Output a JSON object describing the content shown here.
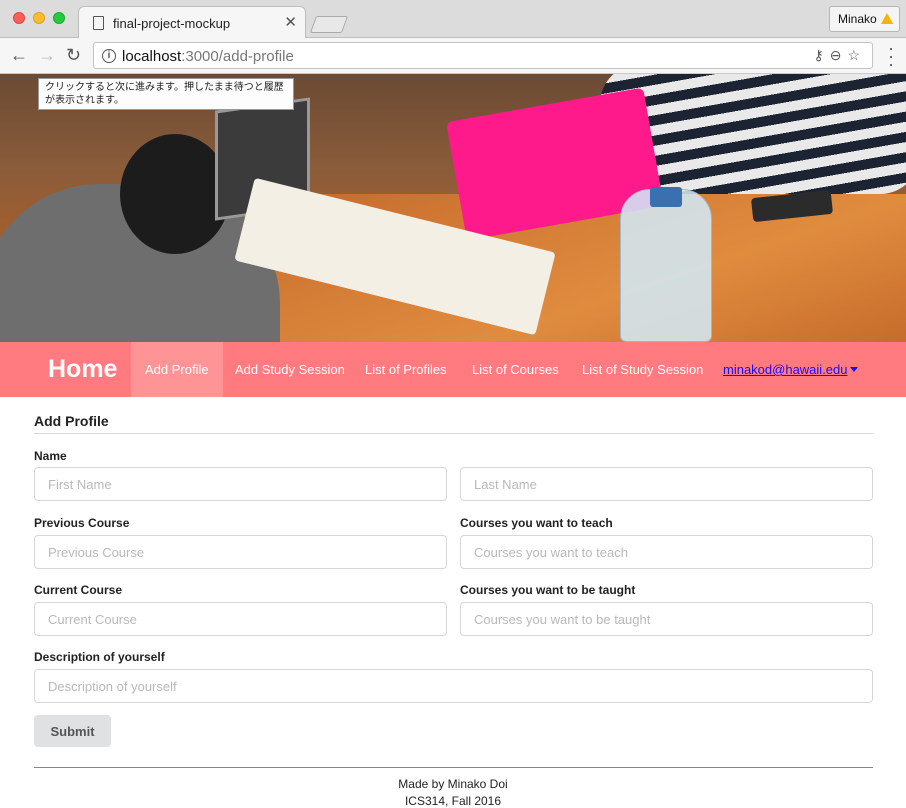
{
  "browser": {
    "tab_title": "final-project-mockup",
    "profile_name": "Minako",
    "url_host": "localhost",
    "url_path": ":3000/add-profile"
  },
  "tooltip": {
    "text": "クリックすると次に進みます。押したまま待つと履歴が表示されます。"
  },
  "navbar": {
    "brand": "Home",
    "items": [
      {
        "label": "Add Profile",
        "active": true
      },
      {
        "label": "Add Study Session",
        "active": false
      },
      {
        "label": "List of Profiles",
        "active": false
      },
      {
        "label": "List of Courses",
        "active": false
      },
      {
        "label": "List of Study Session",
        "active": false
      }
    ],
    "user_email": "minakod@hawaii.edu"
  },
  "form": {
    "title": "Add Profile",
    "name_label": "Name",
    "first_name_placeholder": "First Name",
    "last_name_placeholder": "Last Name",
    "previous_course_label": "Previous Course",
    "previous_course_placeholder": "Previous Course",
    "teach_label": "Courses you want to teach",
    "teach_placeholder": "Courses you want to teach",
    "current_course_label": "Current Course",
    "current_course_placeholder": "Current Course",
    "taught_label": "Courses you want to be taught",
    "taught_placeholder": "Courses you want to be taught",
    "description_label": "Description of yourself",
    "description_placeholder": "Description of yourself",
    "submit_label": "Submit"
  },
  "footer": {
    "line1": "Made by Minako Doi",
    "line2": "ICS314, Fall 2016"
  },
  "colors": {
    "navbar": "#ff7b7f",
    "navbar_active": "#ff9497",
    "user_link": "#1a0dff"
  }
}
